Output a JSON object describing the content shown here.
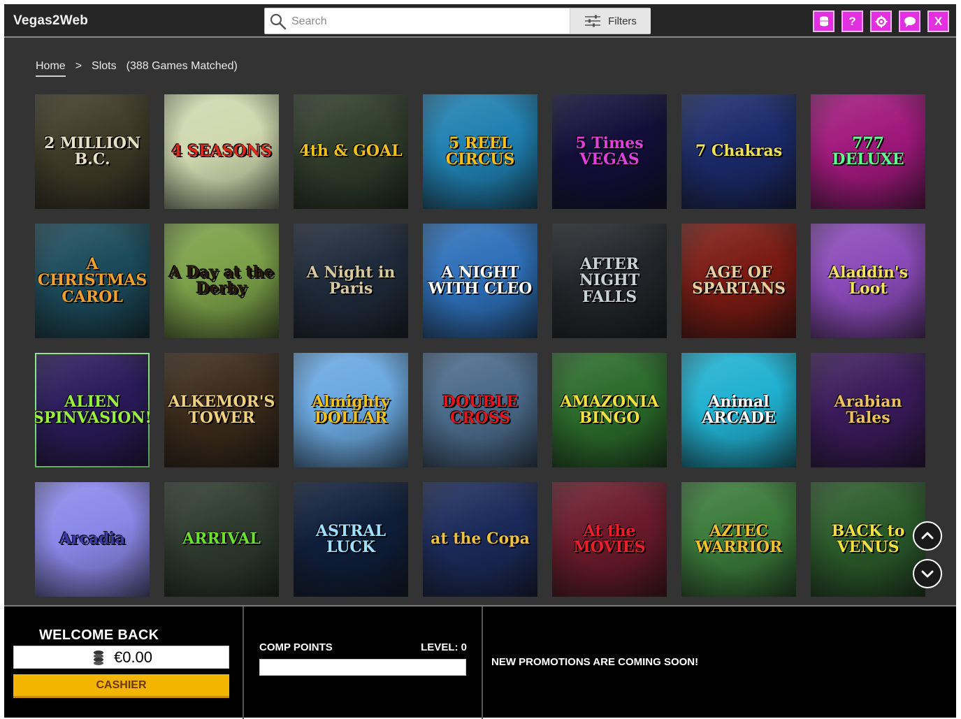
{
  "app": {
    "title": "Vegas2Web"
  },
  "search": {
    "placeholder": "Search",
    "value": "",
    "filters_label": "Filters"
  },
  "header_buttons": [
    {
      "icon": "cashier-icon",
      "label": ""
    },
    {
      "icon": "help-icon",
      "label": "?"
    },
    {
      "icon": "settings-icon",
      "label": ""
    },
    {
      "icon": "chat-icon",
      "label": ""
    },
    {
      "icon": "close-icon",
      "label": "X"
    }
  ],
  "breadcrumb": {
    "home": "Home",
    "separator": ">",
    "current": "Slots",
    "count": "(388 Games Matched)"
  },
  "games": [
    {
      "title": "2 MILLION B.C.",
      "bg": "#3e3a26",
      "fg": "#e8e0c4"
    },
    {
      "title": "4 SEASONS",
      "bg": "#cfd8ae",
      "fg": "#d8281c"
    },
    {
      "title": "4th & GOAL",
      "bg": "#2f3c2a",
      "fg": "#f0c020"
    },
    {
      "title": "5 REEL CIRCUS",
      "bg": "#1f7fb0",
      "fg": "#f4c020"
    },
    {
      "title": "5 Times VEGAS",
      "bg": "#120e3a",
      "fg": "#e040e0"
    },
    {
      "title": "7 Chakras",
      "bg": "#1a2a6a",
      "fg": "#f0e060"
    },
    {
      "title": "777 DELUXE",
      "bg": "#a0187c",
      "fg": "#60ff90"
    },
    {
      "title": "A CHRISTMAS CAROL",
      "bg": "#1b4a5a",
      "fg": "#f0a030"
    },
    {
      "title": "A Day at the Derby",
      "bg": "#7aa048",
      "fg": "#2a1a0e"
    },
    {
      "title": "A Night in Paris",
      "bg": "#1e2a3a",
      "fg": "#d8c8a0"
    },
    {
      "title": "A NIGHT WITH CLEO",
      "bg": "#2d6fb8",
      "fg": "#ffffff"
    },
    {
      "title": "AFTER NIGHT FALLS",
      "bg": "#22262a",
      "fg": "#c8d0d8"
    },
    {
      "title": "AGE OF SPARTANS",
      "bg": "#7a1a12",
      "fg": "#e8d0a0"
    },
    {
      "title": "Aladdin's Loot",
      "bg": "#8a4ab8",
      "fg": "#f8e060"
    },
    {
      "title": "ALIEN SPINVASION!",
      "bg": "#2a1a5a",
      "fg": "#9af040"
    },
    {
      "title": "ALKEMOR'S TOWER",
      "bg": "#3a2a1a",
      "fg": "#f0d080"
    },
    {
      "title": "Almighty DOLLAR",
      "bg": "#6aa8e0",
      "fg": "#f0c020"
    },
    {
      "title": "DOUBLE CROSS",
      "bg": "#4a6a8a",
      "fg": "#e0181c"
    },
    {
      "title": "AMAZONIA BINGO",
      "bg": "#2a6a2a",
      "fg": "#f0e040"
    },
    {
      "title": "Animal ARCADE",
      "bg": "#20b0d0",
      "fg": "#ffffff"
    },
    {
      "title": "Arabian Tales",
      "bg": "#3a1a5a",
      "fg": "#f0c060"
    },
    {
      "title": "Arcadia",
      "bg": "#8a88e8",
      "fg": "#3a3aa8"
    },
    {
      "title": "ARRIVAL",
      "bg": "#2e3a2e",
      "fg": "#6ae030"
    },
    {
      "title": "ASTRAL LUCK",
      "bg": "#0e1e3a",
      "fg": "#a0e0ff"
    },
    {
      "title": "at the Copa",
      "bg": "#1a2a5a",
      "fg": "#f0c040"
    },
    {
      "title": "At the MOVIES",
      "bg": "#6a1a2a",
      "fg": "#e8202c"
    },
    {
      "title": "AZTEC WARRIOR",
      "bg": "#3a7a3a",
      "fg": "#f0c030"
    },
    {
      "title": "BACK to VENUS",
      "bg": "#2a5a2a",
      "fg": "#f0e040"
    }
  ],
  "bottom": {
    "welcome": "WELCOME BACK",
    "balance": "€0.00",
    "cashier": "CASHIER",
    "comp_points_label": "COMP POINTS",
    "level_label": "LEVEL: 0",
    "comp_progress": 0,
    "promo": "NEW PROMOTIONS ARE COMING SOON!"
  }
}
